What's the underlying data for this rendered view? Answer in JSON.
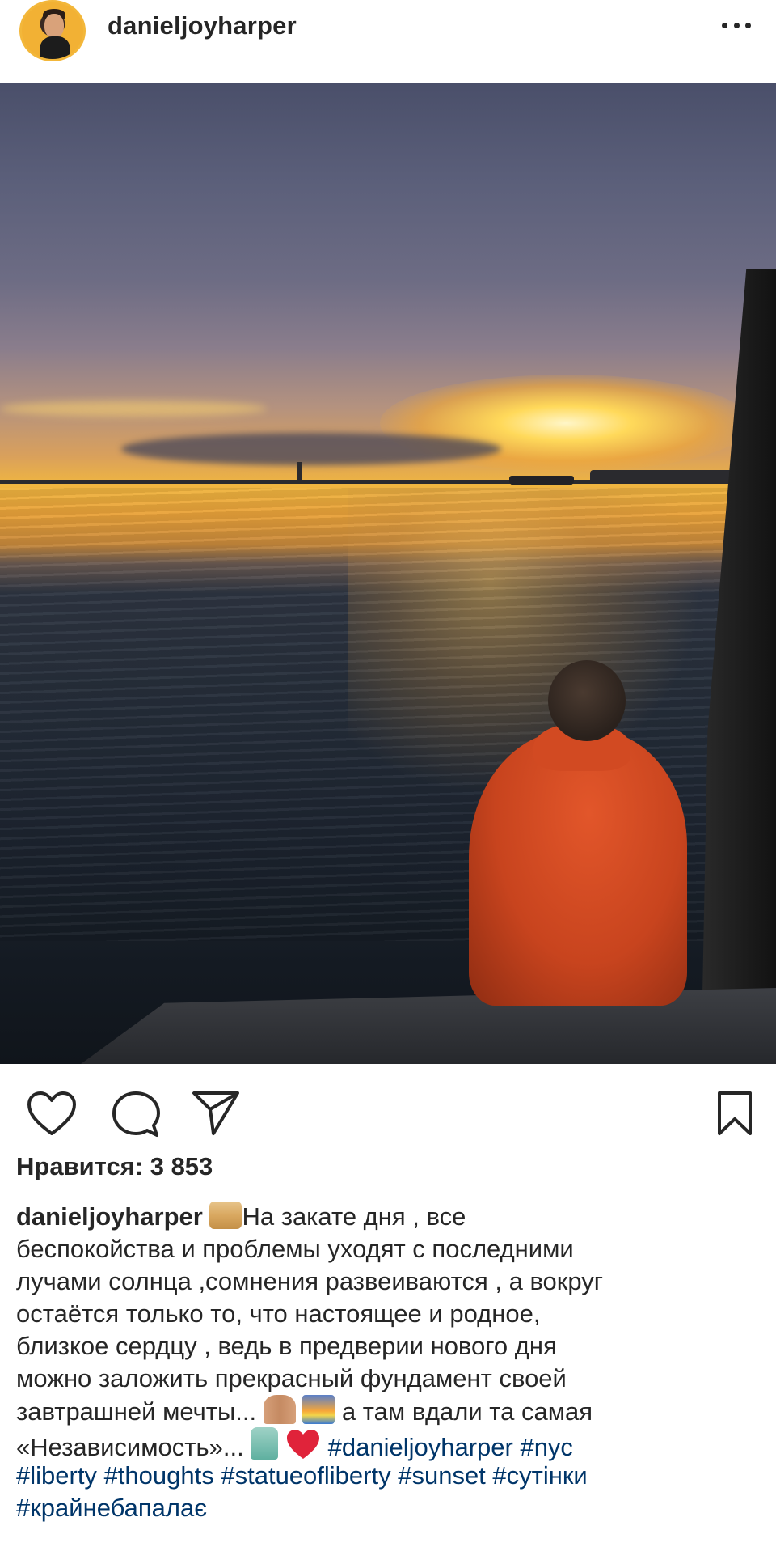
{
  "header": {
    "username": "danieljoyharper",
    "more_icon": "ellipsis-icon"
  },
  "actions": {
    "like_icon": "heart-outline-icon",
    "comment_icon": "comment-bubble-icon",
    "share_icon": "paper-plane-icon",
    "save_icon": "bookmark-icon"
  },
  "likes": {
    "text": "Нравится: 3 853"
  },
  "caption": {
    "username": "danieljoyharper",
    "line1": "На закате дня , все",
    "line2": "беспокойства и проблемы уходят с последними",
    "line3": "лучами солнца ,сомнения развеиваются , а вокруг",
    "line4": "остаётся только то, что настоящее и родное,",
    "line5": "близкое сердцу , ведь в предверии нового дня",
    "line6": "можно заложить прекрасный фундамент своей",
    "line7a": "завтрашней мечты...",
    "line7b": "а там вдали та самая",
    "line8": "«Независимость»...",
    "hashtags": {
      "danieljoyharper": "#danieljoyharper",
      "nyc": "#nyc",
      "liberty": "#liberty",
      "thoughts": "#thoughts",
      "statueofliberty": "#statueofliberty",
      "sunset": "#sunset",
      "sutinky": "#сутінки",
      "krayne": "#крайнебапалає"
    },
    "emojis": [
      "scroll-emoji",
      "pray-emoji",
      "sunrise-emoji",
      "statue-of-liberty-emoji",
      "red-heart-emoji"
    ]
  },
  "colors": {
    "text": "#262626",
    "hashtag": "#003569",
    "avatar_ring": "#f3b73a"
  }
}
